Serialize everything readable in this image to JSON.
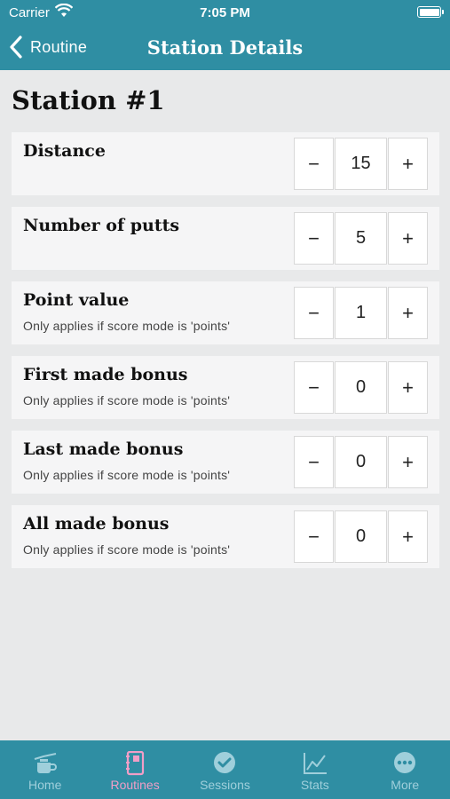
{
  "status_bar": {
    "carrier": "Carrier",
    "time": "7:05 PM"
  },
  "nav": {
    "back_label": "Routine",
    "title": "Station Details"
  },
  "page": {
    "title": "Station #1"
  },
  "stations": [
    {
      "label": "Distance",
      "subtitle": "",
      "value": "15"
    },
    {
      "label": "Number of putts",
      "subtitle": "",
      "value": "5"
    },
    {
      "label": "Point value",
      "subtitle": "Only applies if score mode is 'points'",
      "value": "1"
    },
    {
      "label": "First made bonus",
      "subtitle": "Only applies if score mode is 'points'",
      "value": "0"
    },
    {
      "label": "Last made bonus",
      "subtitle": "Only applies if score mode is 'points'",
      "value": "0"
    },
    {
      "label": "All made bonus",
      "subtitle": "Only applies if score mode is 'points'",
      "value": "0"
    }
  ],
  "stepper": {
    "minus": "−",
    "plus": "+"
  },
  "tabs": [
    {
      "label": "Home",
      "icon": "home-icon"
    },
    {
      "label": "Routines",
      "icon": "routines-icon"
    },
    {
      "label": "Sessions",
      "icon": "sessions-icon"
    },
    {
      "label": "Stats",
      "icon": "stats-icon"
    },
    {
      "label": "More",
      "icon": "more-icon"
    }
  ],
  "colors": {
    "header": "#2f8ea3",
    "tab_inactive": "#9fcfdb",
    "tab_active": "#f19ec7",
    "background": "#e8e9ea"
  }
}
